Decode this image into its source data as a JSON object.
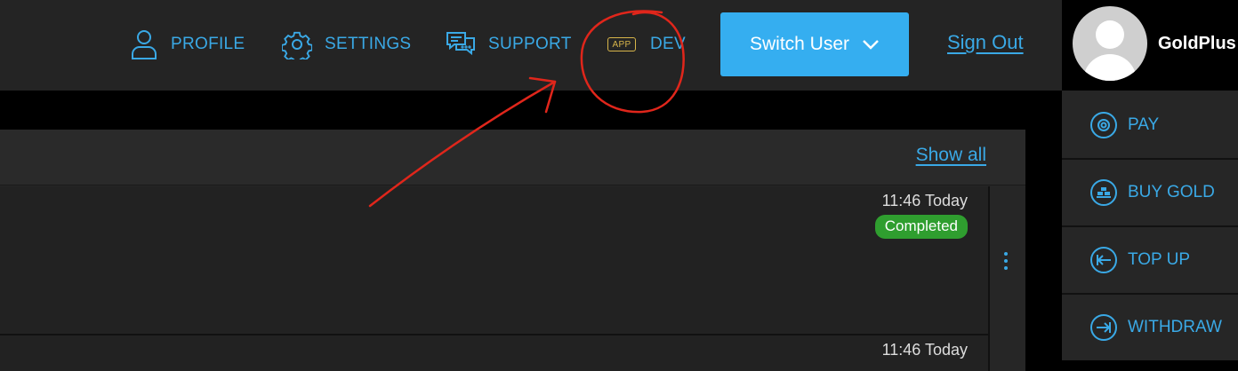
{
  "nav": {
    "profile": "PROFILE",
    "settings": "SETTINGS",
    "support": "SUPPORT",
    "dev_badge": "APP",
    "dev": "DEV"
  },
  "switch_user": "Switch User",
  "sign_out": "Sign Out",
  "user": {
    "name": "GoldPlus"
  },
  "sidebar": {
    "items": [
      {
        "label": "PAY",
        "icon": "pay-icon"
      },
      {
        "label": "BUY GOLD",
        "icon": "gold-bars-icon"
      },
      {
        "label": "TOP UP",
        "icon": "top-up-icon"
      },
      {
        "label": "WITHDRAW",
        "icon": "withdraw-icon"
      }
    ]
  },
  "panel": {
    "show_all": "Show all",
    "rows": [
      {
        "time": "11:46  Today",
        "status": "Completed"
      },
      {
        "time": "11:46  Today"
      }
    ]
  },
  "colors": {
    "accent": "#3aa9e6",
    "button": "#35aef0",
    "success": "#2f9e2f",
    "annotation": "#e0261b"
  }
}
